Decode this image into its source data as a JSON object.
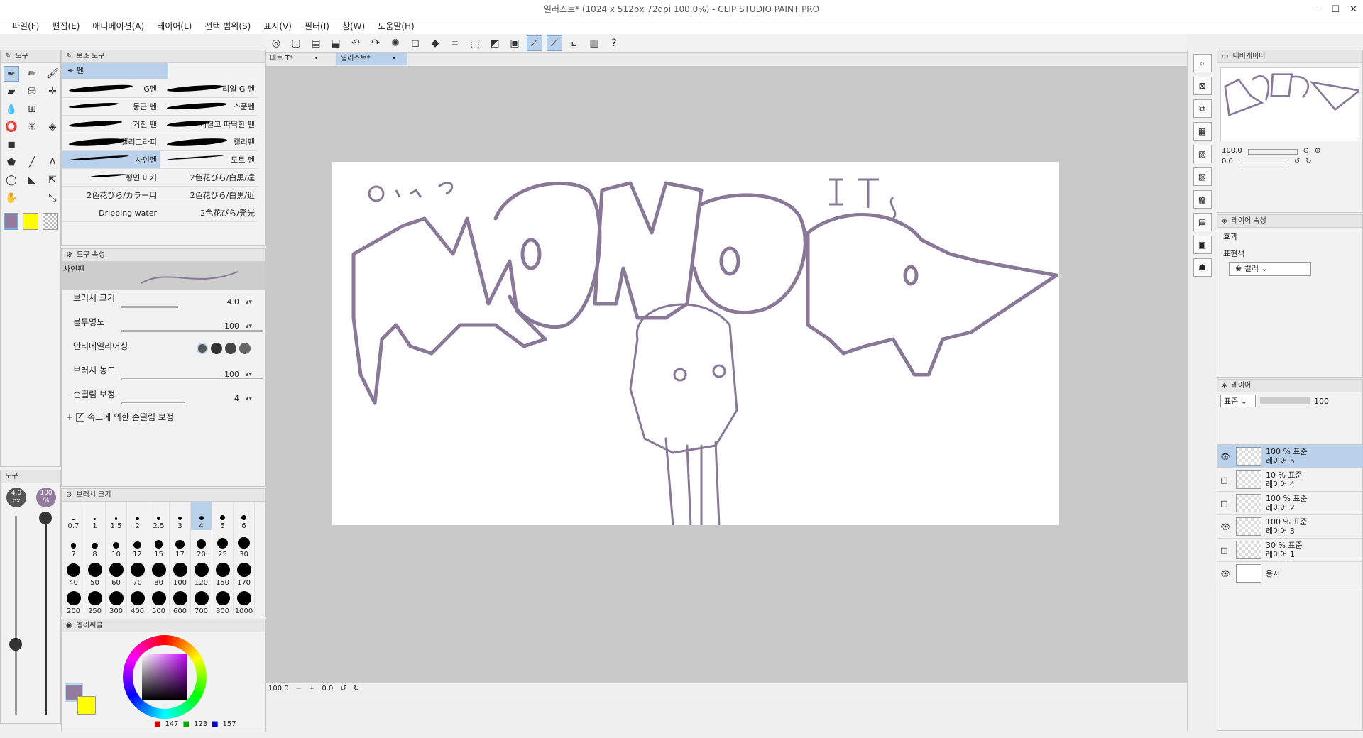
{
  "window": {
    "title": "일러스트* (1024 x 512px 72dpi 100.0%) - CLIP STUDIO PAINT PRO",
    "minimize": "─",
    "maximize": "☐",
    "close": "✕"
  },
  "menu": [
    "파일(F)",
    "편집(E)",
    "애니메이션(A)",
    "레이어(L)",
    "선택 범위(S)",
    "표시(V)",
    "필터(I)",
    "창(W)",
    "도움말(H)"
  ],
  "tool_panel": {
    "tab": "도구"
  },
  "subtool_panel": {
    "tab": "보조 도구",
    "group": "펜",
    "brushes": [
      [
        "G펜",
        "리얼 G 펜"
      ],
      [
        "둥근 펜",
        "스푼펜"
      ],
      [
        "거친 펜",
        "거칠고 따딱한 펜"
      ],
      [
        "캘리그라피",
        "캘리펜"
      ],
      [
        "사인펜",
        "도트 펜"
      ],
      [
        "평면 마커",
        "2色花びら/白黒/達"
      ],
      [
        "2色花びら/カラー用",
        "2色花びら/白黒/近"
      ],
      [
        "Dripping water",
        "2色花びら/発光"
      ]
    ]
  },
  "tool_property": {
    "tab": "도구 속성",
    "tool_name": "사인펜",
    "brush_size_label": "브러시 크기",
    "brush_size": "4.0",
    "opacity_label": "불투명도",
    "opacity": "100",
    "antialias_label": "안티에일리어싱",
    "density_label": "브러시 농도",
    "density": "100",
    "stabilization_label": "손떨림 보정",
    "stabilization": "4",
    "speed_stab_label": "속도에 의한 손떨림 보정"
  },
  "mini_panel": {
    "tab": "도구",
    "size_badge": "4.0 px",
    "opacity_badge": "100 %"
  },
  "brush_size_panel": {
    "tab": "브러시 크기",
    "sizes": [
      "0.7",
      "1",
      "1.5",
      "2",
      "2.5",
      "3",
      "4",
      "5",
      "6",
      "7",
      "8",
      "10",
      "12",
      "15",
      "17",
      "20",
      "25",
      "30",
      "40",
      "50",
      "60",
      "70",
      "80",
      "100",
      "120",
      "150",
      "170",
      "200",
      "250",
      "300",
      "400",
      "500",
      "600",
      "700",
      "800",
      "1000"
    ]
  },
  "color_panel": {
    "tab": "컬러써클",
    "r": "147",
    "g": "123",
    "b": "157",
    "main_color": "#937b9d",
    "sub_color": "#ffff00"
  },
  "canvas": {
    "tabs": [
      "테트 T*",
      "일러스트*"
    ],
    "zoom": "100.0",
    "angle": "0.0",
    "stroke_color": "#8a7898"
  },
  "navigator": {
    "tab": "내비게이터",
    "zoom": "100.0",
    "angle": "0.0"
  },
  "layer_property": {
    "tab": "레이어 속성",
    "effect_label": "효과",
    "expression_label": "표현색",
    "expression_value": "컬러"
  },
  "layers": {
    "tab": "레이어",
    "blend_mode": "표준",
    "opacity": "100",
    "items": [
      {
        "meta": "100 % 표준",
        "name": "레이어 5",
        "visible": true,
        "selected": true
      },
      {
        "meta": "10 % 표준",
        "name": "레이어 4",
        "visible": false,
        "selected": false
      },
      {
        "meta": "100 % 표준",
        "name": "레이어 2",
        "visible": false,
        "selected": false
      },
      {
        "meta": "100 % 표준",
        "name": "레이어 3",
        "visible": true,
        "selected": false
      },
      {
        "meta": "30 % 표준",
        "name": "레이어 1",
        "visible": false,
        "selected": false
      },
      {
        "meta": "",
        "name": "용지",
        "visible": true,
        "selected": false
      }
    ]
  }
}
